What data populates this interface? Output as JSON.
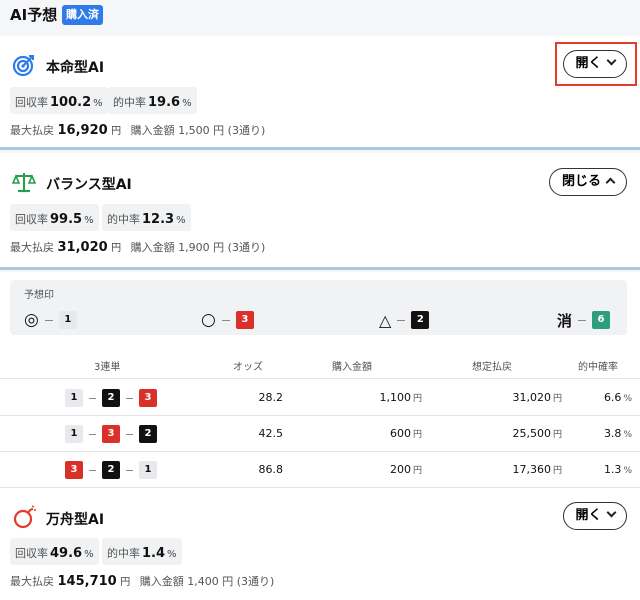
{
  "header": {
    "title": "AI予想",
    "badge": "購入済"
  },
  "cards": [
    {
      "name": "本命型AI",
      "button": "開く",
      "recovery_label": "回収率",
      "recovery_value": "100.2",
      "recovery_unit": "%",
      "hit_label": "的中率",
      "hit_value": "19.6",
      "hit_unit": "%",
      "maxpay_label": "最大払戻",
      "maxpay_value": "16,920",
      "maxpay_unit": "円",
      "purchase_label": "購入金額",
      "purchase_value": "1,500 円 (3通り)"
    },
    {
      "name": "バランス型AI",
      "button": "閉じる",
      "recovery_label": "回収率",
      "recovery_value": "99.5",
      "recovery_unit": "%",
      "hit_label": "的中率",
      "hit_value": "12.3",
      "hit_unit": "%",
      "maxpay_label": "最大払戻",
      "maxpay_value": "31,020",
      "maxpay_unit": "円",
      "purchase_label": "購入金額",
      "purchase_value": "1,900 円 (3通り)"
    },
    {
      "name": "万舟型AI",
      "button": "開く",
      "recovery_label": "回収率",
      "recovery_value": "49.6",
      "recovery_unit": "%",
      "hit_label": "的中率",
      "hit_value": "1.4",
      "hit_unit": "%",
      "maxpay_label": "最大払戻",
      "maxpay_value": "145,710",
      "maxpay_unit": "円",
      "purchase_label": "購入金額",
      "purchase_value": "1,400 円 (3通り)"
    }
  ],
  "marks": {
    "title": "予想印",
    "items": [
      {
        "symbol": "◎",
        "boat": "1"
      },
      {
        "symbol": "○",
        "boat": "3"
      },
      {
        "symbol": "△",
        "boat": "2"
      },
      {
        "symbol": "消",
        "boat": "6"
      }
    ]
  },
  "table": {
    "headers": [
      "3連単",
      "オッズ",
      "購入金額",
      "想定払戻",
      "的中確率"
    ],
    "rows": [
      {
        "b1": "1",
        "b2": "2",
        "b3": "3",
        "odds": "28.2",
        "amount": "1,100",
        "payout": "31,020",
        "prob": "6.6"
      },
      {
        "b1": "1",
        "b2": "3",
        "b3": "2",
        "odds": "42.5",
        "amount": "600",
        "payout": "25,500",
        "prob": "3.8"
      },
      {
        "b1": "3",
        "b2": "2",
        "b3": "1",
        "odds": "86.8",
        "amount": "200",
        "payout": "17,360",
        "prob": "1.3"
      }
    ],
    "yen": "円",
    "percent": "%"
  },
  "colors": {
    "accent_blue": "#2f7ce8",
    "boat_red": "#d9302a",
    "boat_black": "#111111",
    "boat_green": "#2e9d7b",
    "highlight": "#e23b2a"
  },
  "icons": {
    "card1": "target-icon",
    "card2": "balance-scale-icon",
    "card3": "bomb-icon"
  }
}
